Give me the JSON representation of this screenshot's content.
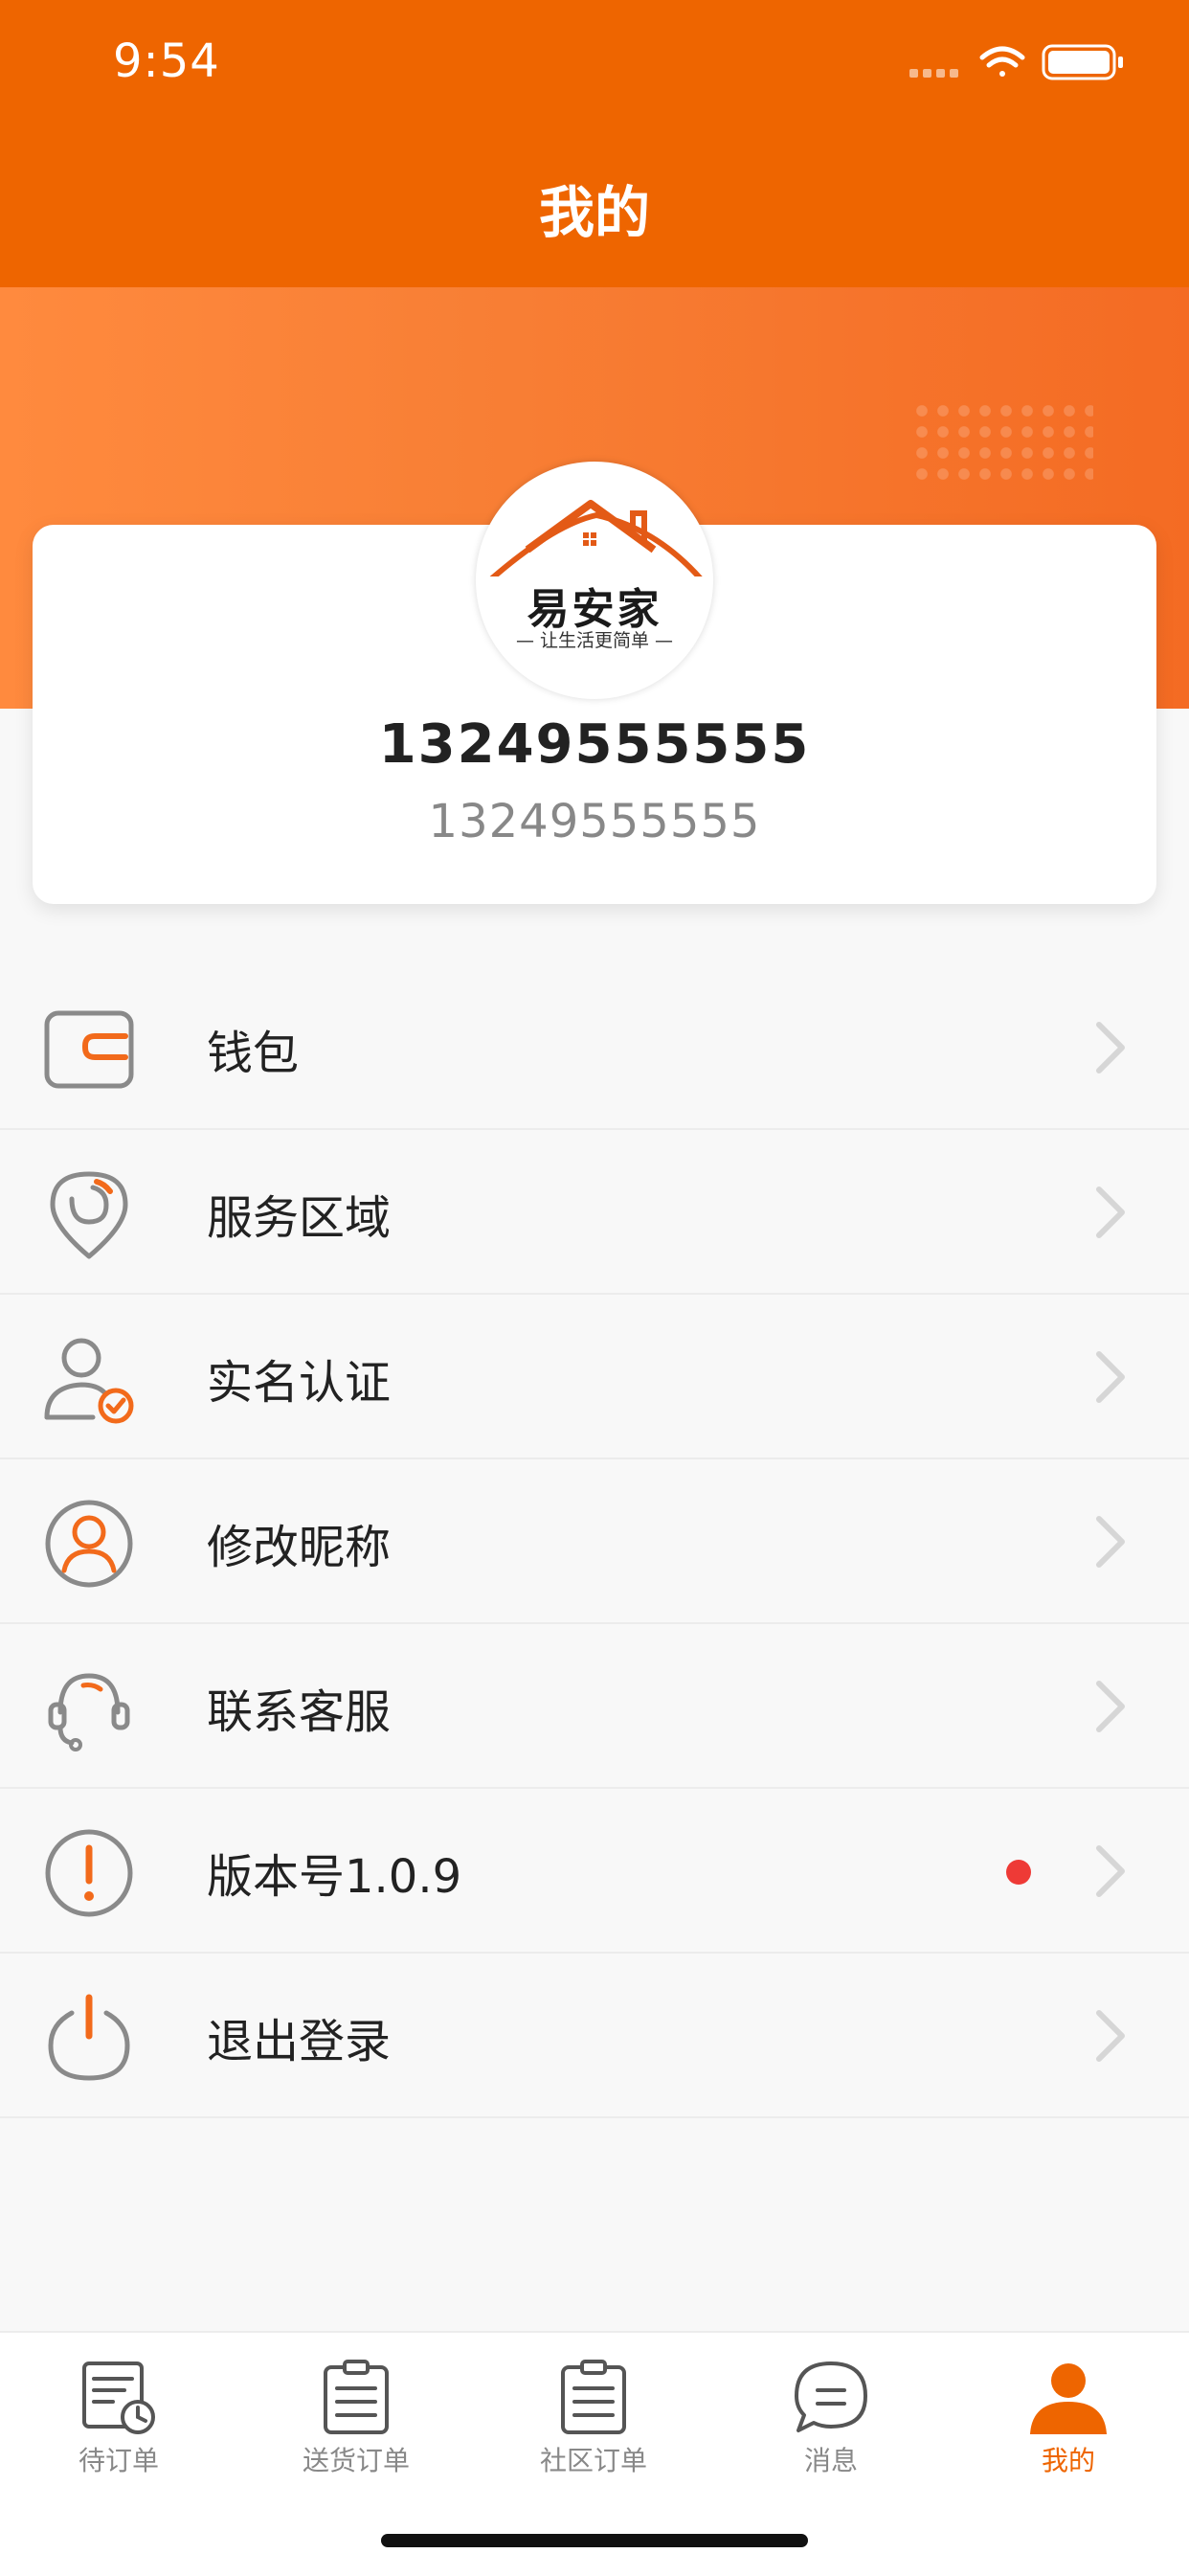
{
  "status_bar": {
    "time": "9:54"
  },
  "nav": {
    "title": "我的"
  },
  "profile": {
    "logo_text": "易安家",
    "logo_slogan": "— 让生活更简单 —",
    "phone_primary": "13249555555",
    "phone_secondary": "13249555555"
  },
  "menu": {
    "items": [
      {
        "label": "钱包",
        "icon": "wallet-icon"
      },
      {
        "label": "服务区域",
        "icon": "location-pin-icon"
      },
      {
        "label": "实名认证",
        "icon": "user-verified-icon"
      },
      {
        "label": "修改昵称",
        "icon": "user-circle-icon"
      },
      {
        "label": "联系客服",
        "icon": "headset-icon"
      },
      {
        "label": "版本号1.0.9",
        "icon": "exclamation-icon",
        "badge": "red-dot"
      },
      {
        "label": "退出登录",
        "icon": "power-icon"
      }
    ]
  },
  "tab_bar": {
    "tabs": [
      {
        "label": "待订单",
        "icon": "order-pending-icon",
        "active": false
      },
      {
        "label": "送货订单",
        "icon": "delivery-order-icon",
        "active": false
      },
      {
        "label": "社区订单",
        "icon": "community-order-icon",
        "active": false
      },
      {
        "label": "消息",
        "icon": "message-icon",
        "active": false
      },
      {
        "label": "我的",
        "icon": "profile-icon",
        "active": true
      }
    ]
  },
  "colors": {
    "brand": "#ee6500",
    "icon_gray": "#8a8a8a",
    "icon_accent": "#f26a1b",
    "badge": "#ee3a36"
  }
}
